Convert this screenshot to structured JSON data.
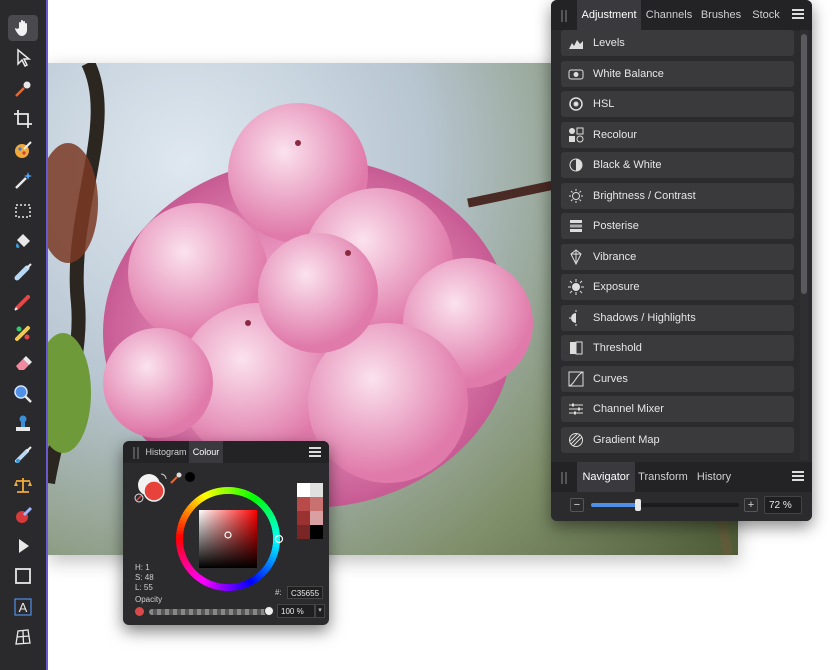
{
  "studio": {
    "tabs": [
      "Adjustment",
      "Channels",
      "Brushes",
      "Stock"
    ],
    "active_tab": "Adjustment",
    "adjustments": [
      {
        "label": "Levels",
        "icon": "levels-icon"
      },
      {
        "label": "White Balance",
        "icon": "white-balance-icon"
      },
      {
        "label": "HSL",
        "icon": "hsl-icon"
      },
      {
        "label": "Recolour",
        "icon": "recolour-icon"
      },
      {
        "label": "Black & White",
        "icon": "black-white-icon"
      },
      {
        "label": "Brightness / Contrast",
        "icon": "brightness-contrast-icon"
      },
      {
        "label": "Posterise",
        "icon": "posterise-icon"
      },
      {
        "label": "Vibrance",
        "icon": "vibrance-icon"
      },
      {
        "label": "Exposure",
        "icon": "exposure-icon"
      },
      {
        "label": "Shadows / Highlights",
        "icon": "shadows-highlights-icon"
      },
      {
        "label": "Threshold",
        "icon": "threshold-icon"
      },
      {
        "label": "Curves",
        "icon": "curves-icon"
      },
      {
        "label": "Channel Mixer",
        "icon": "channel-mixer-icon"
      },
      {
        "label": "Gradient Map",
        "icon": "gradient-map-icon"
      }
    ]
  },
  "navigator": {
    "tabs": [
      "Navigator",
      "Transform",
      "History"
    ],
    "active_tab": "Navigator",
    "zoom_label": "72 %",
    "zoom_fraction": 0.32,
    "minus": "−",
    "plus": "+"
  },
  "colour_panel": {
    "tabs": [
      "Histogram",
      "Colour"
    ],
    "active_tab": "Colour",
    "h": "H: 1",
    "s": "S: 48",
    "l": "L: 55",
    "hex_prefix": "#:",
    "hex": "C35655",
    "opacity_label": "Opacity",
    "opacity_value": "100 %",
    "opacity_fraction": 1.0,
    "current_colour": "#c35655",
    "swatches": [
      "#ffffff",
      "#e0e0e0",
      "#b94a4a",
      "#c97070",
      "#9a3232",
      "#d8a0a0",
      "#7a2626",
      "#000000"
    ]
  },
  "tools": [
    "hand-tool-icon",
    "move-tool-icon",
    "colour-picker-icon",
    "crop-tool-icon",
    "paint-mixer-icon",
    "magic-wand-icon",
    "marquee-selection-icon",
    "flood-fill-icon",
    "paint-brush-icon",
    "pencil-icon",
    "healing-brush-icon",
    "eraser-icon",
    "zoom-lens-icon",
    "clone-stamp-icon",
    "smudge-brush-icon",
    "scales-icon",
    "red-eye-icon",
    "node-tool-icon",
    "rectangle-tool-icon",
    "text-tool-icon",
    "mesh-warp-icon"
  ],
  "colors": {
    "accent": "#4f8fe8",
    "panel_bg": "#2b2b2e",
    "active_tab_bg": "#3a3a3e"
  }
}
